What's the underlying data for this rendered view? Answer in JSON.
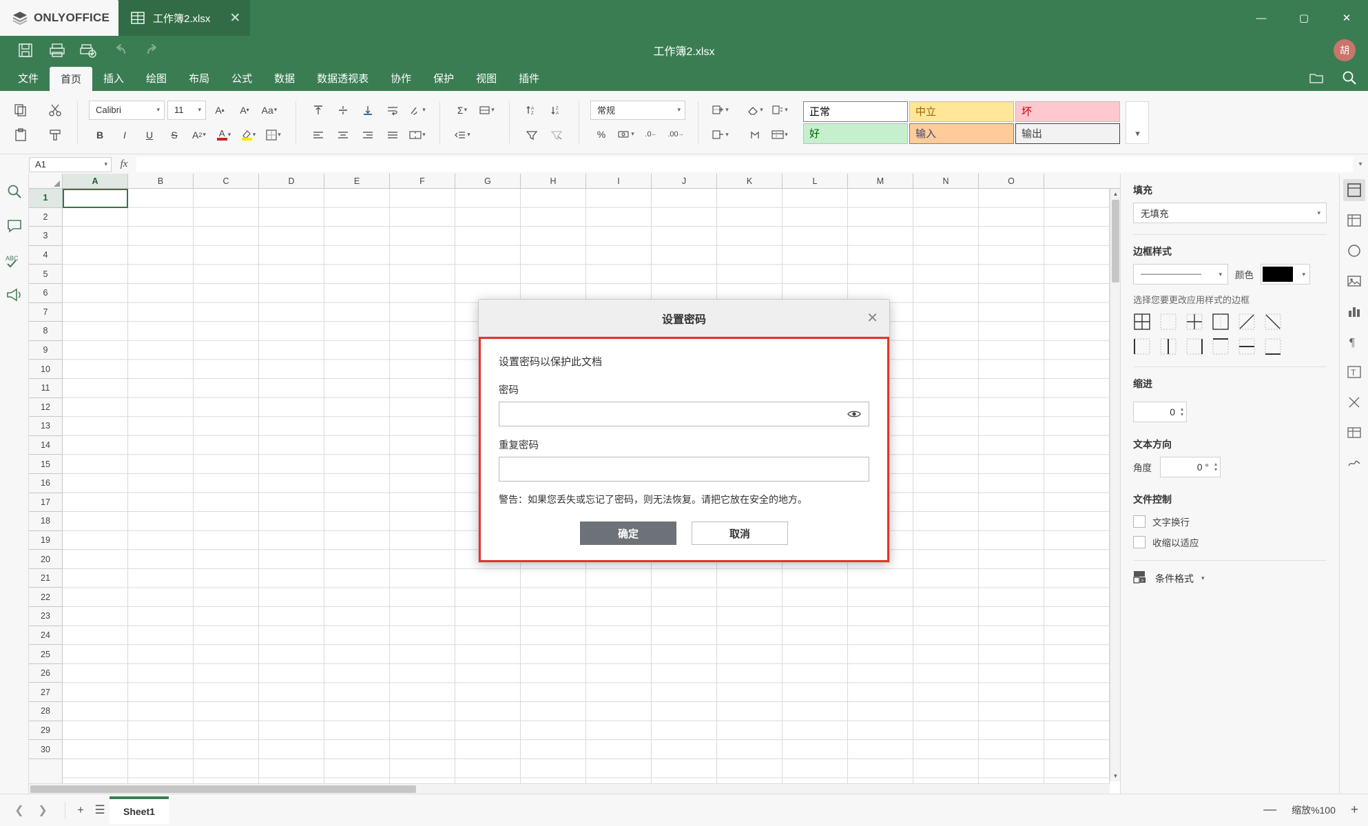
{
  "app": {
    "brand": "ONLYOFFICE",
    "document_title": "工作簿2.xlsx",
    "tab_name": "工作簿2.xlsx",
    "avatar_initial": "胡",
    "accent_color": "#3a7d52",
    "dialog_border_color": "#e8332a"
  },
  "window_controls": {
    "minimize": "—",
    "maximize": "▢",
    "close": "✕"
  },
  "quick_access": [
    {
      "name": "save-icon",
      "title": "保存"
    },
    {
      "name": "print-icon",
      "title": "打印"
    },
    {
      "name": "quick-print-icon",
      "title": "快速打印"
    },
    {
      "name": "undo-icon",
      "title": "撤销"
    },
    {
      "name": "redo-icon",
      "title": "恢复"
    }
  ],
  "menu": {
    "tabs": [
      {
        "label": "文件",
        "active": false
      },
      {
        "label": "首页",
        "active": true
      },
      {
        "label": "插入",
        "active": false
      },
      {
        "label": "绘图",
        "active": false
      },
      {
        "label": "布局",
        "active": false
      },
      {
        "label": "公式",
        "active": false
      },
      {
        "label": "数据",
        "active": false
      },
      {
        "label": "数据透视表",
        "active": false
      },
      {
        "label": "协作",
        "active": false
      },
      {
        "label": "保护",
        "active": false
      },
      {
        "label": "视图",
        "active": false
      },
      {
        "label": "插件",
        "active": false
      }
    ]
  },
  "ribbon": {
    "font_name": "Calibri",
    "font_size": "11",
    "number_format": "常规",
    "cell_styles": [
      {
        "label": "正常",
        "bg": "#ffffff",
        "fg": "#000000",
        "border": "#7f7f7f"
      },
      {
        "label": "中立",
        "bg": "#ffe699",
        "fg": "#9c6500",
        "border": "#cfcfcf"
      },
      {
        "label": "坏",
        "bg": "#ffc7ce",
        "fg": "#c00000",
        "border": "#cfcfcf"
      },
      {
        "label": "好",
        "bg": "#c6efce",
        "fg": "#006100",
        "border": "#cfcfcf"
      },
      {
        "label": "输入",
        "bg": "#ffcc99",
        "fg": "#3f3f76",
        "border": "#7f7f7f"
      },
      {
        "label": "输出",
        "bg": "#f2f2f2",
        "fg": "#3f3f3f",
        "border": "#3f3f3f"
      }
    ]
  },
  "formula_bar": {
    "name_box": "A1",
    "fx_label": "fx",
    "formula_value": ""
  },
  "grid": {
    "columns": [
      "A",
      "B",
      "C",
      "D",
      "E",
      "F",
      "G",
      "H",
      "I",
      "J",
      "K",
      "L",
      "M",
      "N",
      "O"
    ],
    "rows": [
      1,
      2,
      3,
      4,
      5,
      6,
      7,
      8,
      9,
      10,
      11,
      12,
      13,
      14,
      15,
      16,
      17,
      18,
      19,
      20,
      21,
      22,
      23,
      24,
      25,
      26,
      27,
      28,
      29,
      30
    ],
    "active_cell": "A1"
  },
  "right_panel": {
    "fill_title": "填充",
    "fill_value": "无填充",
    "border_style_title": "边框样式",
    "border_line_value": "————————",
    "color_label": "颜色",
    "color_value": "#000000",
    "border_hint": "选择您要更改应用样式的边框",
    "indent_title": "缩进",
    "indent_value": "0",
    "text_direction_title": "文本方向",
    "angle_label": "角度",
    "angle_value": "0 °",
    "file_control_title": "文件控制",
    "wrap_text_label": "文字换行",
    "shrink_to_fit_label": "收缩以适应",
    "conditional_format_label": "条件格式"
  },
  "status_bar": {
    "add_sheet": "+",
    "sheet_list": "☰",
    "sheets": [
      {
        "name": "Sheet1",
        "active": true
      }
    ],
    "zoom_label": "缩放%100",
    "zoom_out": "—",
    "zoom_in": "+"
  },
  "dialog": {
    "title": "设置密码",
    "close": "✕",
    "lead": "设置密码以保护此文档",
    "password_label": "密码",
    "password_value": "",
    "password_placeholder": "",
    "repeat_label": "重复密码",
    "repeat_value": "",
    "repeat_placeholder": "",
    "warning": "警告：如果您丢失或忘记了密码，则无法恢复。请把它放在安全的地方。",
    "ok_label": "确定",
    "cancel_label": "取消"
  }
}
